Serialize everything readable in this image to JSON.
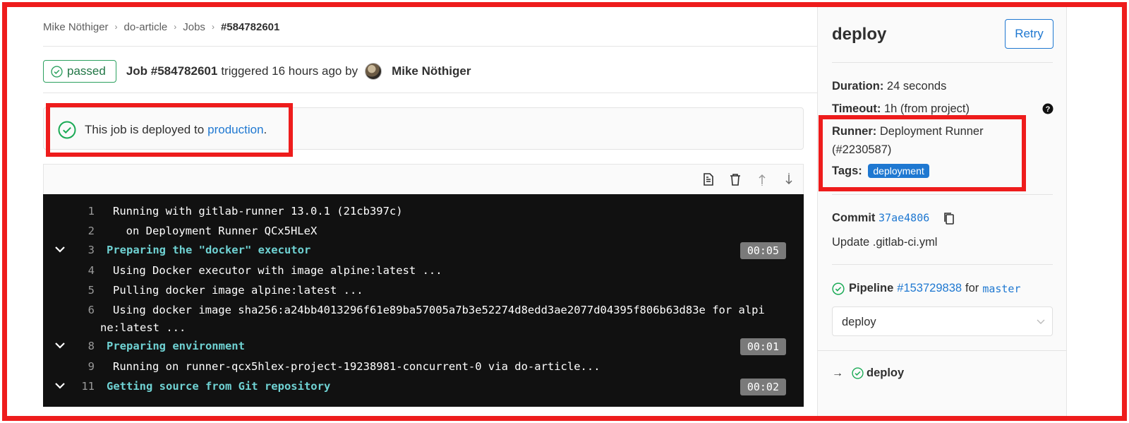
{
  "breadcrumb": {
    "items": [
      "Mike Nöthiger",
      "do-article",
      "Jobs",
      "#584782601"
    ]
  },
  "job": {
    "status": "passed",
    "title": "Job #584782601",
    "triggered_text": "triggered 16 hours ago by",
    "author": "Mike Nöthiger"
  },
  "deployment": {
    "prefix": "This job is deployed to",
    "environment": "production",
    "suffix": "."
  },
  "log": {
    "lines": [
      {
        "num": "1",
        "text": "Running with gitlab-runner 13.0.1 (21cb397c)"
      },
      {
        "num": "2",
        "text": "  on Deployment Runner QCx5HLeX"
      },
      {
        "num": "3",
        "text": "Preparing the \"docker\" executor",
        "duration": "00:05"
      },
      {
        "num": "4",
        "text": "Using Docker executor with image alpine:latest ..."
      },
      {
        "num": "5",
        "text": "Pulling docker image alpine:latest ..."
      },
      {
        "num": "6",
        "text": "Using docker image sha256:a24bb4013296f61e89ba57005a7b3e52274d8edd3ae2077d04395f806b63d83e for alpi"
      },
      {
        "num": "",
        "text": "ne:latest ..."
      },
      {
        "num": "8",
        "text": "Preparing environment",
        "duration": "00:01"
      },
      {
        "num": "9",
        "text": "Running on runner-qcx5hlex-project-19238981-concurrent-0 via do-article..."
      },
      {
        "num": "11",
        "text": "Getting source from Git repository",
        "duration": "00:02"
      }
    ]
  },
  "sidebar": {
    "title": "deploy",
    "retry_label": "Retry",
    "duration_label": "Duration:",
    "duration_value": "24 seconds",
    "timeout_label": "Timeout:",
    "timeout_value": "1h (from project)",
    "runner_label": "Runner:",
    "runner_value": "Deployment Runner",
    "runner_id": "(#2230587)",
    "tags_label": "Tags:",
    "tag": "deployment",
    "commit_label": "Commit",
    "commit_sha": "37ae4806",
    "commit_message": "Update .gitlab-ci.yml",
    "pipeline_label": "Pipeline",
    "pipeline_id": "#153729838",
    "pipeline_for": "for",
    "branch": "master",
    "stage_select": "deploy",
    "job_arrow": "→",
    "job_name": "deploy"
  },
  "colors": {
    "accent": "#1f78d1",
    "success": "#1aaa55",
    "highlight": "#ee1c1c",
    "log_bg": "#111111",
    "section_text": "#6fd2d3"
  },
  "icons": [
    "check-circle-icon",
    "raw-log-icon",
    "erase-log-icon",
    "scroll-top-icon",
    "scroll-bottom-icon",
    "chevron-down-icon",
    "question-icon",
    "copy-icon"
  ]
}
